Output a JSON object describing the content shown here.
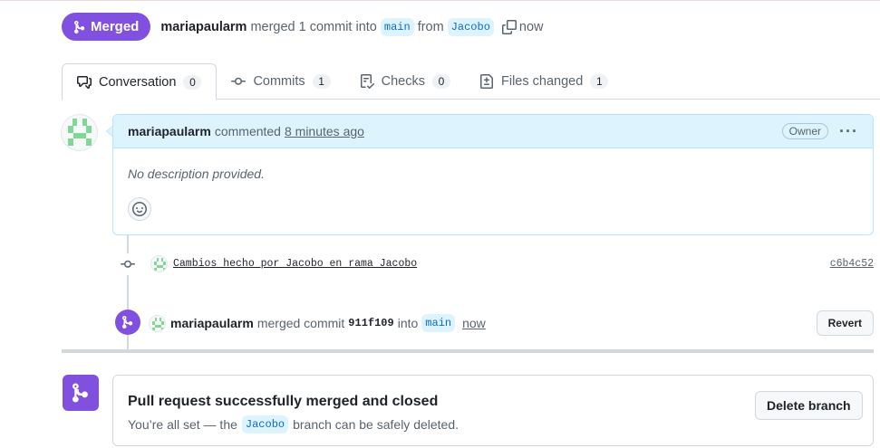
{
  "header": {
    "state": "Merged",
    "author": "mariapaularm",
    "merged_text": "merged 1 commit into",
    "base_branch": "main",
    "from_text": "from",
    "head_branch": "Jacobo",
    "time": "now"
  },
  "tabs": [
    {
      "label": "Conversation",
      "count": "0",
      "icon": "comment-discussion-icon"
    },
    {
      "label": "Commits",
      "count": "1",
      "icon": "git-commit-icon"
    },
    {
      "label": "Checks",
      "count": "0",
      "icon": "checklist-icon"
    },
    {
      "label": "Files changed",
      "count": "1",
      "icon": "file-diff-icon"
    }
  ],
  "comment": {
    "author": "mariapaularm",
    "action": "commented",
    "time": "8 minutes ago",
    "role": "Owner",
    "body": "No description provided."
  },
  "commit": {
    "message": "Cambios hecho por Jacobo en rama Jacobo",
    "sha": "c6b4c52"
  },
  "merge_event": {
    "author": "mariapaularm",
    "text": "merged commit",
    "sha": "911f109",
    "into_text": "into",
    "branch": "main",
    "time": "now",
    "revert_label": "Revert"
  },
  "merge_box": {
    "title": "Pull request successfully merged and closed",
    "sub_before": "You’re all set — the",
    "branch": "Jacobo",
    "sub_after": "branch can be safely deleted.",
    "delete_label": "Delete branch"
  },
  "colors": {
    "merged": "#8250df",
    "branch_bg": "#ddf4ff",
    "branch_fg": "#0969da",
    "comment_header": "#ddf4ff",
    "identicon": "#7dd993"
  }
}
